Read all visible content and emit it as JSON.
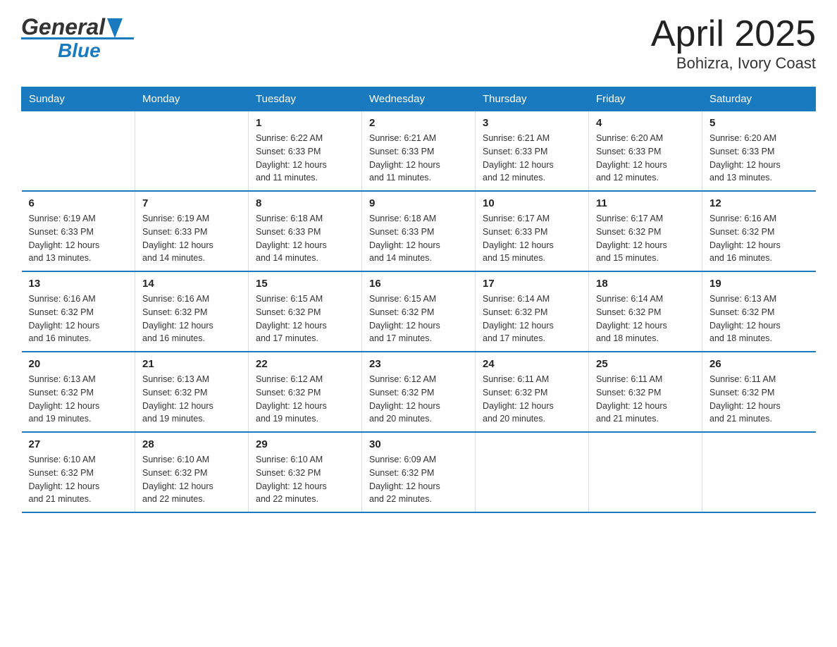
{
  "header": {
    "logo_general": "General",
    "logo_blue": "Blue",
    "title": "April 2025",
    "subtitle": "Bohizra, Ivory Coast"
  },
  "days_of_week": [
    "Sunday",
    "Monday",
    "Tuesday",
    "Wednesday",
    "Thursday",
    "Friday",
    "Saturday"
  ],
  "weeks": [
    [
      {
        "day": "",
        "info": ""
      },
      {
        "day": "",
        "info": ""
      },
      {
        "day": "1",
        "info": "Sunrise: 6:22 AM\nSunset: 6:33 PM\nDaylight: 12 hours\nand 11 minutes."
      },
      {
        "day": "2",
        "info": "Sunrise: 6:21 AM\nSunset: 6:33 PM\nDaylight: 12 hours\nand 11 minutes."
      },
      {
        "day": "3",
        "info": "Sunrise: 6:21 AM\nSunset: 6:33 PM\nDaylight: 12 hours\nand 12 minutes."
      },
      {
        "day": "4",
        "info": "Sunrise: 6:20 AM\nSunset: 6:33 PM\nDaylight: 12 hours\nand 12 minutes."
      },
      {
        "day": "5",
        "info": "Sunrise: 6:20 AM\nSunset: 6:33 PM\nDaylight: 12 hours\nand 13 minutes."
      }
    ],
    [
      {
        "day": "6",
        "info": "Sunrise: 6:19 AM\nSunset: 6:33 PM\nDaylight: 12 hours\nand 13 minutes."
      },
      {
        "day": "7",
        "info": "Sunrise: 6:19 AM\nSunset: 6:33 PM\nDaylight: 12 hours\nand 14 minutes."
      },
      {
        "day": "8",
        "info": "Sunrise: 6:18 AM\nSunset: 6:33 PM\nDaylight: 12 hours\nand 14 minutes."
      },
      {
        "day": "9",
        "info": "Sunrise: 6:18 AM\nSunset: 6:33 PM\nDaylight: 12 hours\nand 14 minutes."
      },
      {
        "day": "10",
        "info": "Sunrise: 6:17 AM\nSunset: 6:33 PM\nDaylight: 12 hours\nand 15 minutes."
      },
      {
        "day": "11",
        "info": "Sunrise: 6:17 AM\nSunset: 6:32 PM\nDaylight: 12 hours\nand 15 minutes."
      },
      {
        "day": "12",
        "info": "Sunrise: 6:16 AM\nSunset: 6:32 PM\nDaylight: 12 hours\nand 16 minutes."
      }
    ],
    [
      {
        "day": "13",
        "info": "Sunrise: 6:16 AM\nSunset: 6:32 PM\nDaylight: 12 hours\nand 16 minutes."
      },
      {
        "day": "14",
        "info": "Sunrise: 6:16 AM\nSunset: 6:32 PM\nDaylight: 12 hours\nand 16 minutes."
      },
      {
        "day": "15",
        "info": "Sunrise: 6:15 AM\nSunset: 6:32 PM\nDaylight: 12 hours\nand 17 minutes."
      },
      {
        "day": "16",
        "info": "Sunrise: 6:15 AM\nSunset: 6:32 PM\nDaylight: 12 hours\nand 17 minutes."
      },
      {
        "day": "17",
        "info": "Sunrise: 6:14 AM\nSunset: 6:32 PM\nDaylight: 12 hours\nand 17 minutes."
      },
      {
        "day": "18",
        "info": "Sunrise: 6:14 AM\nSunset: 6:32 PM\nDaylight: 12 hours\nand 18 minutes."
      },
      {
        "day": "19",
        "info": "Sunrise: 6:13 AM\nSunset: 6:32 PM\nDaylight: 12 hours\nand 18 minutes."
      }
    ],
    [
      {
        "day": "20",
        "info": "Sunrise: 6:13 AM\nSunset: 6:32 PM\nDaylight: 12 hours\nand 19 minutes."
      },
      {
        "day": "21",
        "info": "Sunrise: 6:13 AM\nSunset: 6:32 PM\nDaylight: 12 hours\nand 19 minutes."
      },
      {
        "day": "22",
        "info": "Sunrise: 6:12 AM\nSunset: 6:32 PM\nDaylight: 12 hours\nand 19 minutes."
      },
      {
        "day": "23",
        "info": "Sunrise: 6:12 AM\nSunset: 6:32 PM\nDaylight: 12 hours\nand 20 minutes."
      },
      {
        "day": "24",
        "info": "Sunrise: 6:11 AM\nSunset: 6:32 PM\nDaylight: 12 hours\nand 20 minutes."
      },
      {
        "day": "25",
        "info": "Sunrise: 6:11 AM\nSunset: 6:32 PM\nDaylight: 12 hours\nand 21 minutes."
      },
      {
        "day": "26",
        "info": "Sunrise: 6:11 AM\nSunset: 6:32 PM\nDaylight: 12 hours\nand 21 minutes."
      }
    ],
    [
      {
        "day": "27",
        "info": "Sunrise: 6:10 AM\nSunset: 6:32 PM\nDaylight: 12 hours\nand 21 minutes."
      },
      {
        "day": "28",
        "info": "Sunrise: 6:10 AM\nSunset: 6:32 PM\nDaylight: 12 hours\nand 22 minutes."
      },
      {
        "day": "29",
        "info": "Sunrise: 6:10 AM\nSunset: 6:32 PM\nDaylight: 12 hours\nand 22 minutes."
      },
      {
        "day": "30",
        "info": "Sunrise: 6:09 AM\nSunset: 6:32 PM\nDaylight: 12 hours\nand 22 minutes."
      },
      {
        "day": "",
        "info": ""
      },
      {
        "day": "",
        "info": ""
      },
      {
        "day": "",
        "info": ""
      }
    ]
  ]
}
